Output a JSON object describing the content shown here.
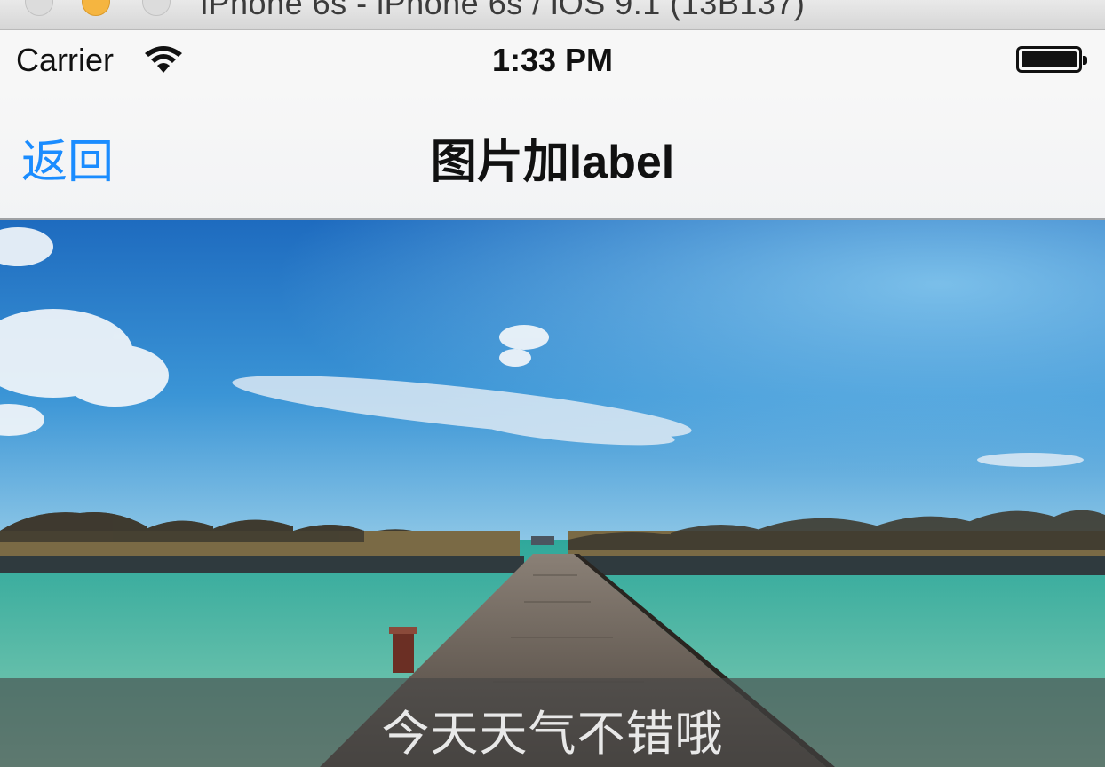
{
  "simulator": {
    "window_title": "iPhone 6s - iPhone 6s / iOS 9.1 (13B137)"
  },
  "status_bar": {
    "carrier": "Carrier",
    "time": "1:33 PM",
    "wifi_icon": "wifi-icon",
    "battery_icon": "battery-icon"
  },
  "nav": {
    "back_label": "返回",
    "title": "图片加label",
    "accent_color": "#1a8cff"
  },
  "content": {
    "image_description_icon": "photo",
    "caption": "今天天气不错哦"
  }
}
